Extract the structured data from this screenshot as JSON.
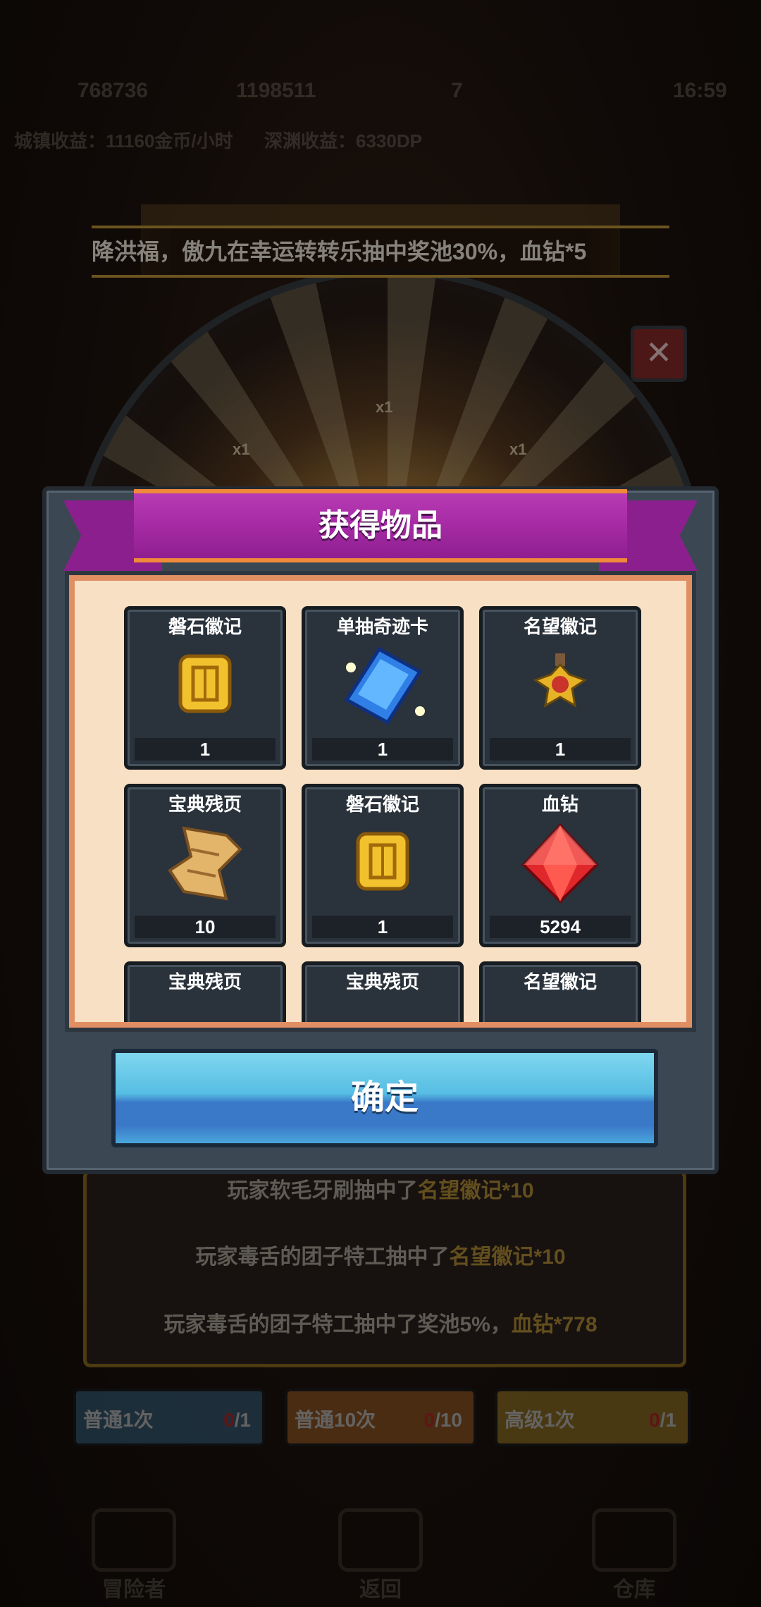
{
  "background": {
    "topbar": {
      "currency1": "768736",
      "currency2": "1198511",
      "currency3": "7",
      "clock": "16:59"
    },
    "income": {
      "gold_rate": "城镇收益：11160金币/小时",
      "dp_rate": "深渊收益：6330DP"
    },
    "ticker_text": "降洪福，傲九在幸运转转乐抽中奖池30%，血钻*5",
    "wheel_labels": [
      "x1",
      "x1",
      "x1"
    ],
    "close_glyph": "✕",
    "log": [
      {
        "text": "玩家软毛牙刷抽中了",
        "item": "名望徽记*10"
      },
      {
        "text": "玩家毒舌的团子特工抽中了",
        "item": "名望徽记*10"
      },
      {
        "text": "玩家毒舌的团子特工抽中了奖池5%，",
        "item": "血钻*778"
      }
    ],
    "draw_buttons": [
      {
        "label": "普通1次",
        "used": "0",
        "total": "/1",
        "color": "#3f6e8f"
      },
      {
        "label": "普通10次",
        "used": "0",
        "total": "/10",
        "color": "#b0682a"
      },
      {
        "label": "高级1次",
        "used": "0",
        "total": "/1",
        "color": "#b08a2a"
      }
    ],
    "bottom_nav": [
      "冒险者",
      "返回",
      "仓库"
    ]
  },
  "dialog": {
    "title": "获得物品",
    "items": [
      {
        "name": "磐石徽记",
        "qty": "1",
        "icon": "gold-emblem-icon"
      },
      {
        "name": "单抽奇迹卡",
        "qty": "1",
        "icon": "blue-card-icon"
      },
      {
        "name": "名望徽记",
        "qty": "1",
        "icon": "medal-icon"
      },
      {
        "name": "宝典残页",
        "qty": "10",
        "icon": "scroll-icon"
      },
      {
        "name": "磐石徽记",
        "qty": "1",
        "icon": "gold-emblem-icon"
      },
      {
        "name": "血钻",
        "qty": "5294",
        "icon": "red-gem-icon"
      },
      {
        "name": "宝典残页",
        "qty": "",
        "icon": "scroll-icon"
      },
      {
        "name": "宝典残页",
        "qty": "",
        "icon": "scroll-icon"
      },
      {
        "name": "名望徽记",
        "qty": "",
        "icon": "medal-icon"
      }
    ],
    "confirm_label": "确定"
  },
  "colors": {
    "ribbon": "#a52aa4",
    "content_bg": "#f8e0c4",
    "slot_bg": "#2a323b",
    "confirm": "#56bde3",
    "highlight": "#e4b341",
    "count_red": "#e53030"
  }
}
